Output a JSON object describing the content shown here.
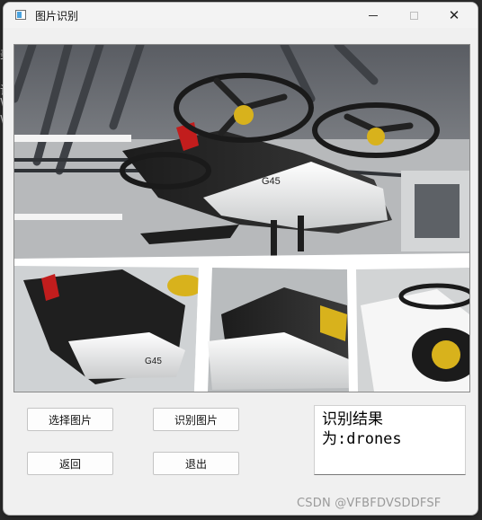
{
  "window": {
    "title": "图片识别",
    "minimize_label": "minimize-icon",
    "maximize_label": "maximize-icon",
    "close_label": "close-icon"
  },
  "image": {
    "description_label": "drone-photo",
    "badge_text": "G45"
  },
  "buttons": {
    "select_image": "选择图片",
    "recognize_image": "识别图片",
    "back": "返回",
    "exit": "退出"
  },
  "result": {
    "text": "识别结果\n为:drones"
  },
  "watermark": {
    "text": "CSDN @VFBFDVSDDFSF"
  },
  "background_glyphs": [
    "美",
    "识",
    "V",
    "V"
  ]
}
